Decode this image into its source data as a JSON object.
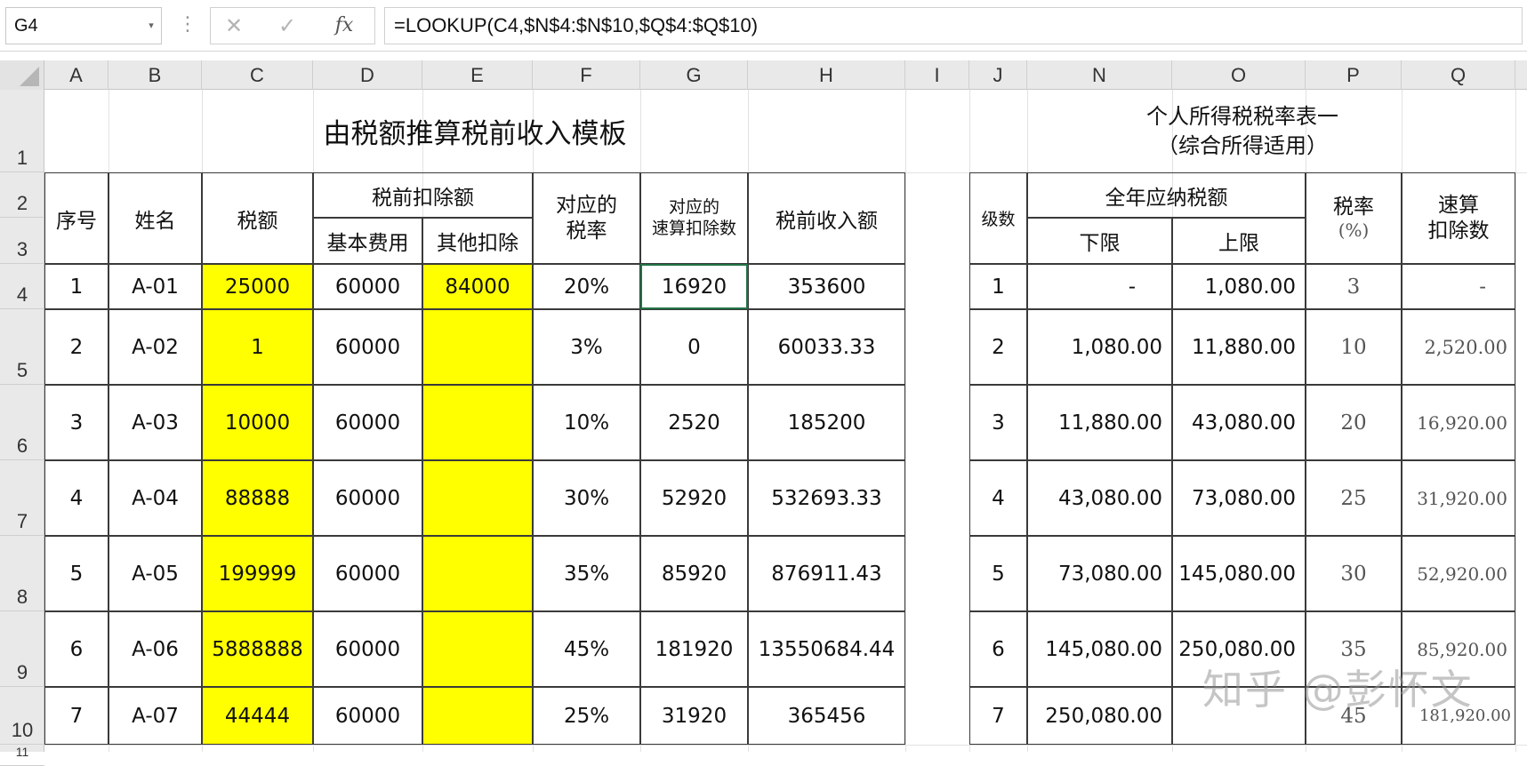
{
  "formula_bar": {
    "name_box": "G4",
    "cancel_icon": "✕",
    "enter_icon": "✓",
    "fx_icon": "fx",
    "formula": "=LOOKUP(C4,$N$4:$N$10,$Q$4:$Q$10)"
  },
  "columns": [
    "A",
    "B",
    "C",
    "D",
    "E",
    "F",
    "G",
    "H",
    "I",
    "J",
    "N",
    "O",
    "P",
    "Q"
  ],
  "rows": [
    "1",
    "2",
    "3",
    "4",
    "5",
    "6",
    "7",
    "8",
    "9",
    "10",
    "11"
  ],
  "left_table": {
    "title": "由税额推算税前收入模板",
    "headers": {
      "seq": "序号",
      "name": "姓名",
      "tax": "税额",
      "deduction_group": "税前扣除额",
      "basic": "基本费用",
      "other": "其他扣除",
      "rate_l1": "对应的",
      "rate_l2": "税率",
      "quick_l1": "对应的",
      "quick_l2": "速算扣除数",
      "income": "税前收入额"
    },
    "rows": [
      {
        "seq": "1",
        "name": "A-01",
        "tax": "25000",
        "basic": "60000",
        "other": "84000",
        "rate": "20%",
        "quick": "16920",
        "income": "353600"
      },
      {
        "seq": "2",
        "name": "A-02",
        "tax": "1",
        "basic": "60000",
        "other": "",
        "rate": "3%",
        "quick": "0",
        "income": "60033.33"
      },
      {
        "seq": "3",
        "name": "A-03",
        "tax": "10000",
        "basic": "60000",
        "other": "",
        "rate": "10%",
        "quick": "2520",
        "income": "185200"
      },
      {
        "seq": "4",
        "name": "A-04",
        "tax": "88888",
        "basic": "60000",
        "other": "",
        "rate": "30%",
        "quick": "52920",
        "income": "532693.33"
      },
      {
        "seq": "5",
        "name": "A-05",
        "tax": "199999",
        "basic": "60000",
        "other": "",
        "rate": "35%",
        "quick": "85920",
        "income": "876911.43"
      },
      {
        "seq": "6",
        "name": "A-06",
        "tax": "5888888",
        "basic": "60000",
        "other": "",
        "rate": "45%",
        "quick": "181920",
        "income": "13550684.44"
      },
      {
        "seq": "7",
        "name": "A-07",
        "tax": "44444",
        "basic": "60000",
        "other": "",
        "rate": "25%",
        "quick": "31920",
        "income": "365456"
      }
    ]
  },
  "right_table": {
    "title_l1": "个人所得税税率表一",
    "title_l2": "（综合所得适用）",
    "headers": {
      "level": "级数",
      "taxable_group": "全年应纳税额",
      "lower": "下限",
      "upper": "上限",
      "rate_l1": "税率",
      "rate_l2": "(%)",
      "quick_l1": "速算",
      "quick_l2": "扣除数"
    },
    "rows": [
      {
        "level": "1",
        "lower": "-",
        "upper": "1,080.00",
        "rate": "3",
        "quick": "-"
      },
      {
        "level": "2",
        "lower": "1,080.00",
        "upper": "11,880.00",
        "rate": "10",
        "quick": "2,520.00"
      },
      {
        "level": "3",
        "lower": "11,880.00",
        "upper": "43,080.00",
        "rate": "20",
        "quick": "16,920.00"
      },
      {
        "level": "4",
        "lower": "43,080.00",
        "upper": "73,080.00",
        "rate": "25",
        "quick": "31,920.00"
      },
      {
        "level": "5",
        "lower": "73,080.00",
        "upper": "145,080.00",
        "rate": "30",
        "quick": "52,920.00"
      },
      {
        "level": "6",
        "lower": "145,080.00",
        "upper": "250,080.00",
        "rate": "35",
        "quick": "85,920.00"
      },
      {
        "level": "7",
        "lower": "250,080.00",
        "upper": "",
        "rate": "45",
        "quick": "181,920.00"
      }
    ]
  },
  "watermark": "知乎 @彭怀文",
  "colors": {
    "input_fill": "#ffff00",
    "header_bg": "#e9e9e9",
    "grid": "#e2e2e2",
    "border": "#3a3a3a"
  }
}
